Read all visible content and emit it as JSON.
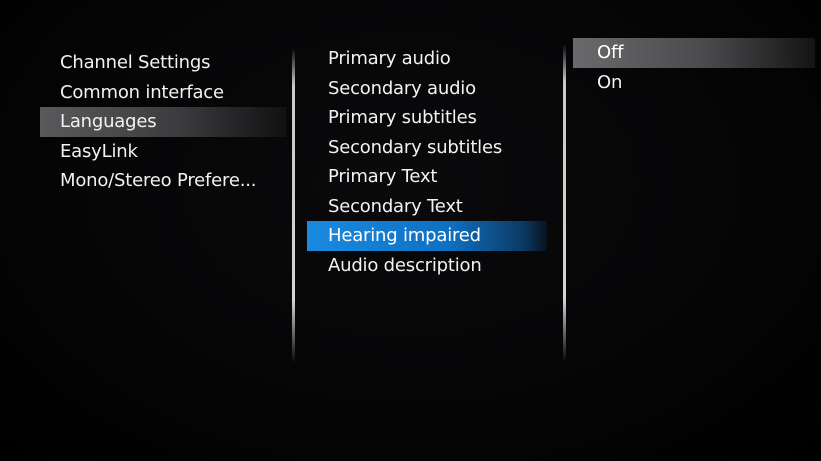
{
  "menu": {
    "categories": [
      {
        "label": "Channel Settings"
      },
      {
        "label": "Common interface"
      },
      {
        "label": "Languages"
      },
      {
        "label": "EasyLink"
      },
      {
        "label": "Mono/Stereo Prefere..."
      }
    ],
    "language_options": [
      {
        "label": "Primary audio"
      },
      {
        "label": "Secondary audio"
      },
      {
        "label": "Primary subtitles"
      },
      {
        "label": "Secondary subtitles"
      },
      {
        "label": "Primary Text"
      },
      {
        "label": "Secondary Text"
      },
      {
        "label": "Hearing impaired"
      },
      {
        "label": "Audio description"
      }
    ],
    "values": [
      {
        "label": "Off"
      },
      {
        "label": "On"
      }
    ],
    "selected_category": "Languages",
    "selected_option": "Hearing impaired",
    "selected_value": "Off"
  },
  "colors": {
    "background": "#000000",
    "text": "#f2f2f2",
    "focus_highlight": "#1a8be0",
    "path_highlight": "#5a5a5c"
  }
}
